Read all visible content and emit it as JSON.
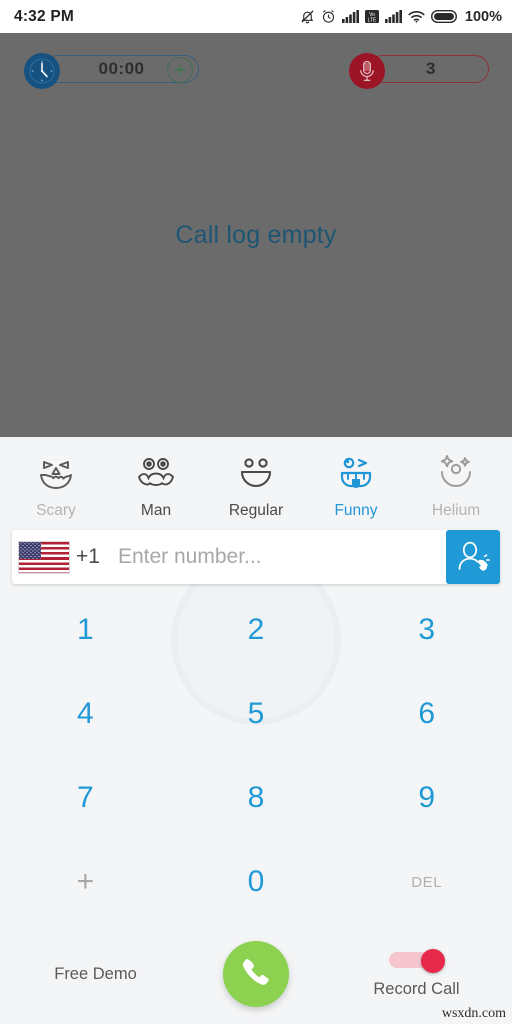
{
  "statusbar": {
    "time": "4:32 PM",
    "battery_label": "100%",
    "icons": [
      "bell-muted-icon",
      "alarm-clock-icon",
      "signal-bars-icon",
      "volte-icon",
      "signal-bars-2-icon",
      "wifi-icon",
      "battery-icon"
    ]
  },
  "calllog": {
    "empty_text": "Call log empty",
    "background_color": "#6b6b6b",
    "text_color": "#1d5673",
    "timer_badge": {
      "icon": "clock-icon",
      "value": "00:00",
      "add_label": "+",
      "accent_color": "#17517f"
    },
    "recording_badge": {
      "icon": "microphone-icon",
      "value": "3",
      "accent_color": "#9c1526"
    }
  },
  "effects": {
    "items": [
      {
        "label": "Scary",
        "icon": "scary-face-icon",
        "state": "dim"
      },
      {
        "label": "Man",
        "icon": "mustache-face-icon",
        "state": "normal"
      },
      {
        "label": "Regular",
        "icon": "smiley-face-icon",
        "state": "normal"
      },
      {
        "label": "Funny",
        "icon": "tongue-face-icon",
        "state": "active"
      },
      {
        "label": "Helium",
        "icon": "sparkle-face-icon",
        "state": "dim"
      }
    ],
    "active_color": "#2196d6"
  },
  "number_row": {
    "flag": "us-flag-icon",
    "country_code": "+1",
    "input_value": "",
    "placeholder": "Enter number...",
    "contacts_button_icon": "contact-person-call-icon",
    "contacts_button_color": "#1f9ad6"
  },
  "keypad": {
    "rows": [
      [
        {
          "label": "1",
          "style": "digit"
        },
        {
          "label": "2",
          "style": "digit"
        },
        {
          "label": "3",
          "style": "digit"
        }
      ],
      [
        {
          "label": "4",
          "style": "digit"
        },
        {
          "label": "5",
          "style": "digit"
        },
        {
          "label": "6",
          "style": "digit"
        }
      ],
      [
        {
          "label": "7",
          "style": "digit"
        },
        {
          "label": "8",
          "style": "digit"
        },
        {
          "label": "9",
          "style": "digit"
        }
      ],
      [
        {
          "label": "+",
          "style": "muted"
        },
        {
          "label": "0",
          "style": "digit"
        },
        {
          "label": "DEL",
          "style": "del"
        }
      ]
    ],
    "digit_color": "#1f9ad6"
  },
  "bottombar": {
    "demo_label": "Free Demo",
    "call_button_icon": "phone-handset-icon",
    "call_button_color": "#8cd14f",
    "record_toggle": {
      "label": "Record Call",
      "state": "on",
      "on_color": "#e6284a"
    }
  },
  "watermark": "wsxdn.com"
}
